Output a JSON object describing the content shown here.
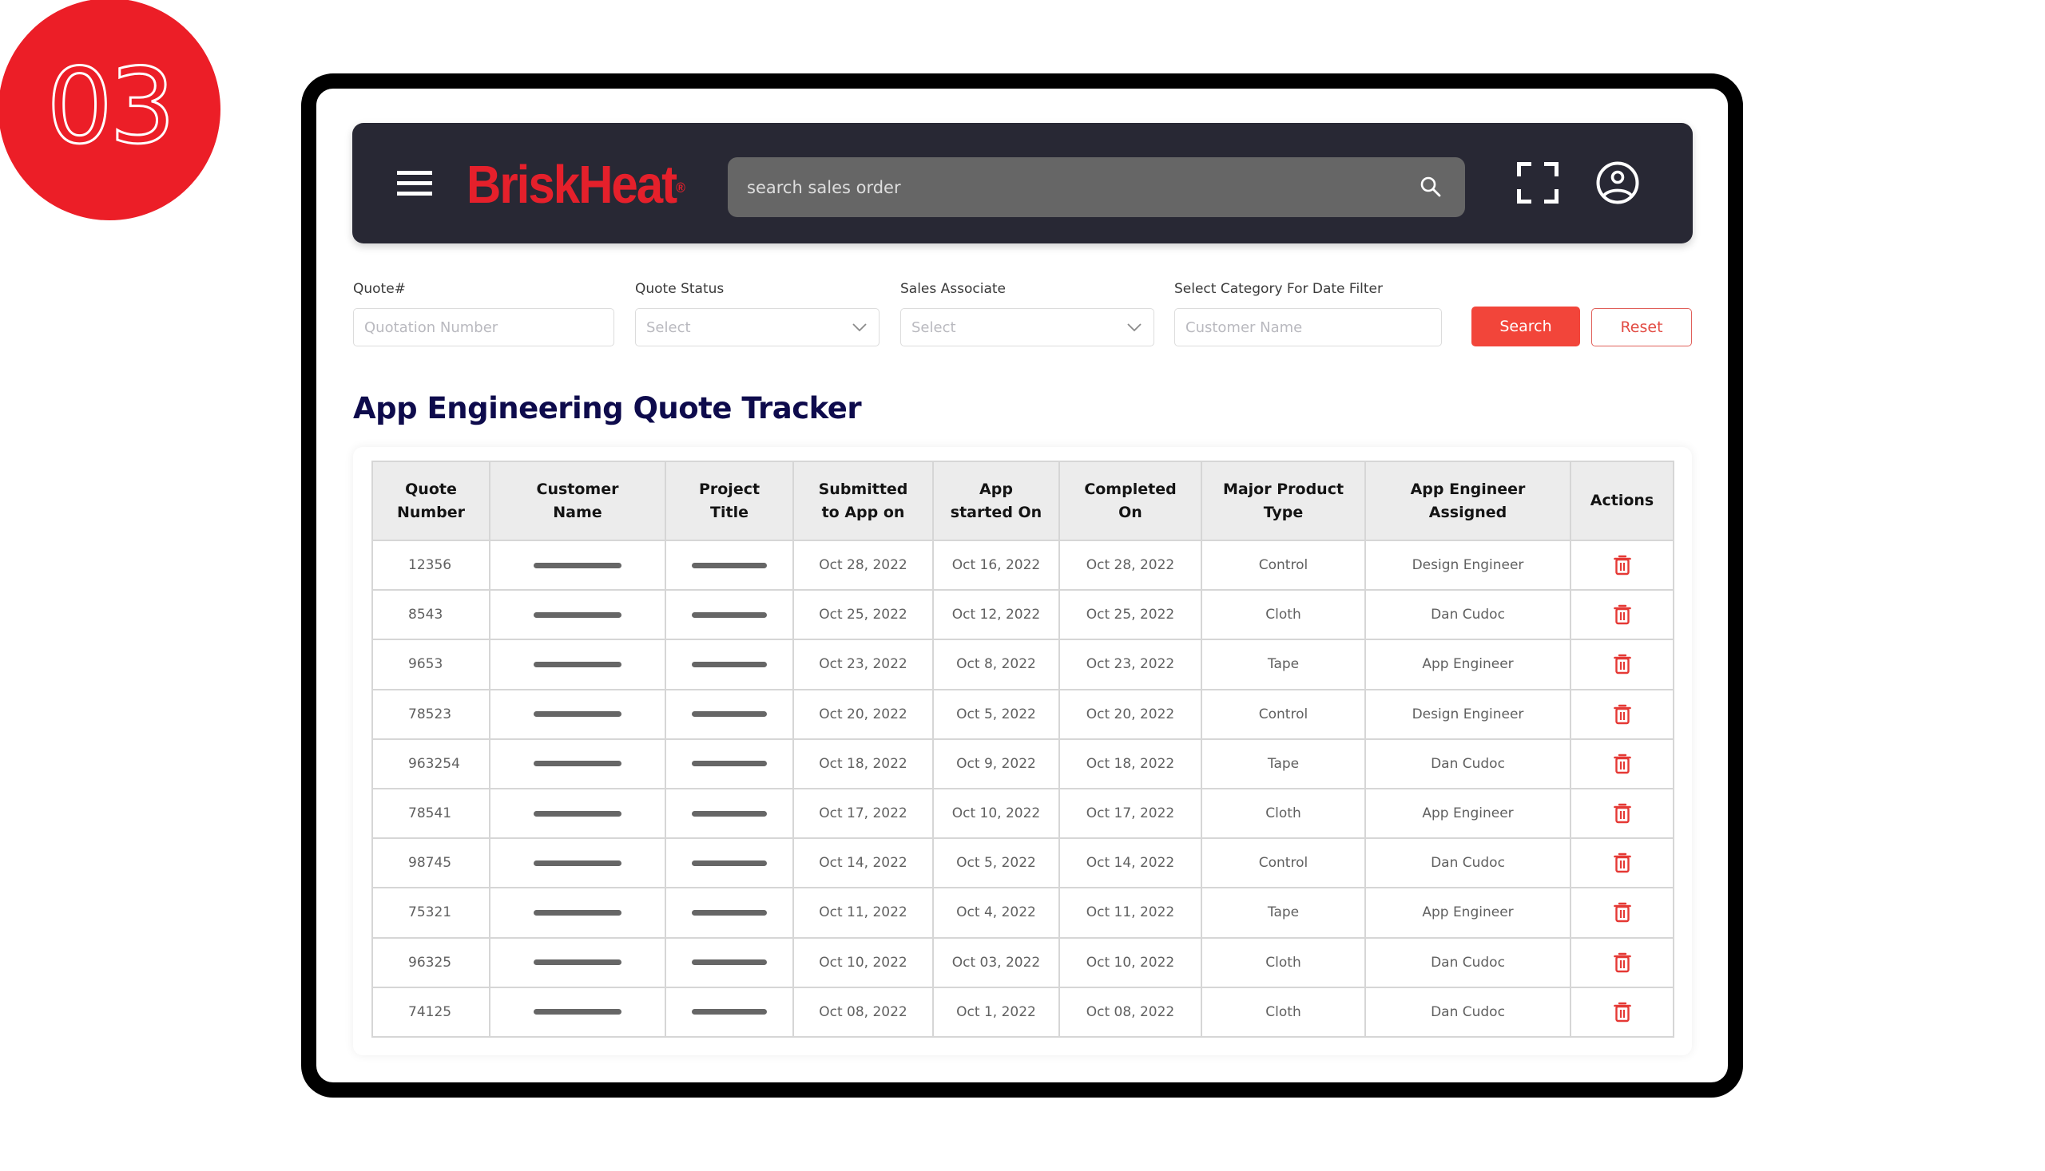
{
  "step_badge": {
    "number": "03",
    "color": "#ec1e27"
  },
  "header": {
    "brand": "BriskHeat",
    "brand_mark": "®",
    "brand_color": "#e5202b",
    "background": "#282834",
    "menu_icon": "hamburger-menu-icon",
    "search": {
      "placeholder": "search sales order",
      "value": "",
      "icon": "search-icon"
    },
    "fullscreen_icon": "fullscreen-icon",
    "profile_icon": "user-circle-icon"
  },
  "filters": {
    "quote_number": {
      "label": "Quote#",
      "placeholder": "Quotation Number",
      "value": ""
    },
    "quote_status": {
      "label": "Quote Status",
      "selected": "Select"
    },
    "sales_associate": {
      "label": "Sales Associate",
      "selected": "Select"
    },
    "date_category": {
      "label": "Select Category For Date Filter",
      "placeholder": "Customer Name",
      "value": ""
    },
    "search_label": "Search",
    "reset_label": "Reset",
    "accent": "#f2453a"
  },
  "page_title": "App Engineering Quote Tracker",
  "table": {
    "columns": [
      "Quote\nNumber",
      "Customer\nName",
      "Project\nTitle",
      "Submitted\nto App on",
      "App\nstarted On",
      "Completed\nOn",
      "Major Product\nType",
      "App Engineer\nAssigned",
      "Actions"
    ],
    "rows": [
      {
        "quote": "12356",
        "customer": "",
        "project": "",
        "submitted": "Oct 28, 2022",
        "started": "Oct 16, 2022",
        "completed": "Oct 28, 2022",
        "product": "Control",
        "engineer": "Design Engineer"
      },
      {
        "quote": "8543",
        "customer": "",
        "project": "",
        "submitted": "Oct 25, 2022",
        "started": "Oct 12, 2022",
        "completed": "Oct 25, 2022",
        "product": "Cloth",
        "engineer": "Dan Cudoc"
      },
      {
        "quote": "9653",
        "customer": "",
        "project": "",
        "submitted": "Oct 23, 2022",
        "started": "Oct 8, 2022",
        "completed": "Oct 23, 2022",
        "product": "Tape",
        "engineer": "App Engineer"
      },
      {
        "quote": "78523",
        "customer": "",
        "project": "",
        "submitted": "Oct 20, 2022",
        "started": "Oct 5, 2022",
        "completed": "Oct 20, 2022",
        "product": "Control",
        "engineer": "Design Engineer"
      },
      {
        "quote": "963254",
        "customer": "",
        "project": "",
        "submitted": "Oct 18, 2022",
        "started": "Oct 9, 2022",
        "completed": "Oct 18, 2022",
        "product": "Tape",
        "engineer": "Dan Cudoc"
      },
      {
        "quote": "78541",
        "customer": "",
        "project": "",
        "submitted": "Oct 17, 2022",
        "started": "Oct 10, 2022",
        "completed": "Oct 17, 2022",
        "product": "Cloth",
        "engineer": "App Engineer"
      },
      {
        "quote": "98745",
        "customer": "",
        "project": "",
        "submitted": "Oct 14, 2022",
        "started": "Oct 5, 2022",
        "completed": "Oct 14, 2022",
        "product": "Control",
        "engineer": "Dan Cudoc"
      },
      {
        "quote": "75321",
        "customer": "",
        "project": "",
        "submitted": "Oct 11, 2022",
        "started": "Oct 4, 2022",
        "completed": "Oct 11, 2022",
        "product": "Tape",
        "engineer": "App Engineer"
      },
      {
        "quote": "96325",
        "customer": "",
        "project": "",
        "submitted": "Oct 10, 2022",
        "started": "Oct 03, 2022",
        "completed": "Oct 10, 2022",
        "product": "Cloth",
        "engineer": "Dan Cudoc"
      },
      {
        "quote": "74125",
        "customer": "",
        "project": "",
        "submitted": "Oct 08, 2022",
        "started": "Oct 1, 2022",
        "completed": "Oct 08, 2022",
        "product": "Cloth",
        "engineer": "Dan Cudoc"
      }
    ],
    "action_icon": "trash-icon",
    "action_color": "#e53935"
  }
}
